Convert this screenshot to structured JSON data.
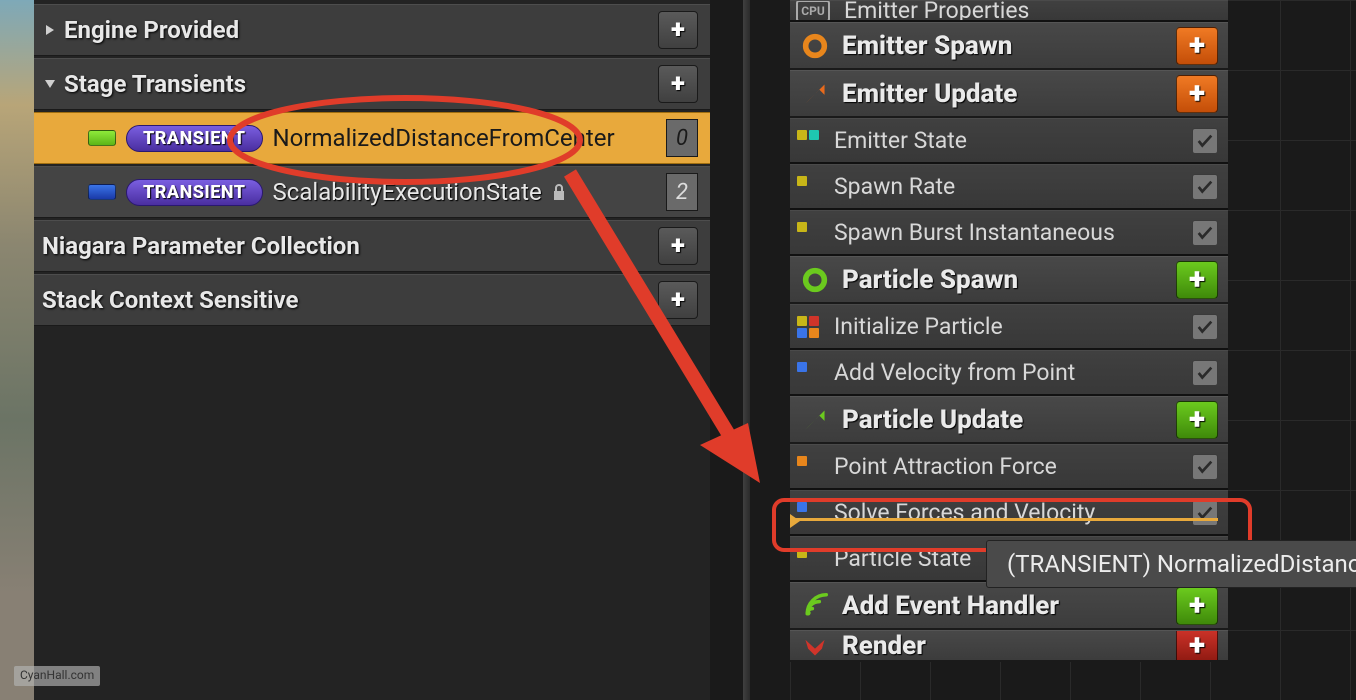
{
  "left": {
    "sections": {
      "engine": {
        "label": "Engine Provided"
      },
      "stage": {
        "label": "Stage Transients"
      },
      "npc": {
        "label": "Niagara Parameter Collection"
      },
      "scs": {
        "label": "Stack Context Sensitive"
      }
    },
    "params": [
      {
        "badge": "TRANSIENT",
        "name": "NormalizedDistanceFromCenter",
        "count": "0",
        "chip": "green",
        "selected": true,
        "locked": false
      },
      {
        "badge": "TRANSIENT",
        "name": "ScalabilityExecutionState",
        "count": "2",
        "chip": "blue",
        "selected": false,
        "locked": true
      }
    ]
  },
  "stack": {
    "top": {
      "cpu": "CPU",
      "label": "Emitter Properties"
    },
    "groups": {
      "emitterSpawn": {
        "label": "Emitter Spawn",
        "add": "orange",
        "ring": "#e8861c"
      },
      "emitterUpdate": {
        "label": "Emitter Update",
        "add": "orange",
        "arrow": "#e86a1c"
      },
      "particleSpawn": {
        "label": "Particle Spawn",
        "add": "green",
        "ring": "#6bca1e"
      },
      "particleUpdate": {
        "label": "Particle Update",
        "add": "green",
        "arrow": "#6bca1e"
      },
      "addEvent": {
        "label": "Add Event Handler",
        "add": "green",
        "wifi": "#6bca1e"
      },
      "render": {
        "label": "Render",
        "add": "red",
        "down": "#d0342a"
      }
    },
    "modules": {
      "emitterState": {
        "label": "Emitter State"
      },
      "spawnRate": {
        "label": "Spawn Rate"
      },
      "spawnBurst": {
        "label": "Spawn Burst Instantaneous"
      },
      "initParticle": {
        "label": "Initialize Particle"
      },
      "addVelPoint": {
        "label": "Add Velocity from Point"
      },
      "pointAttr": {
        "label": "Point Attraction Force"
      },
      "solveFV": {
        "label": "Solve Forces and Velocity"
      },
      "particleState": {
        "label": "Particle State"
      }
    }
  },
  "tooltip": "(TRANSIENT) NormalizedDistance",
  "watermark": "CyanHall.com"
}
